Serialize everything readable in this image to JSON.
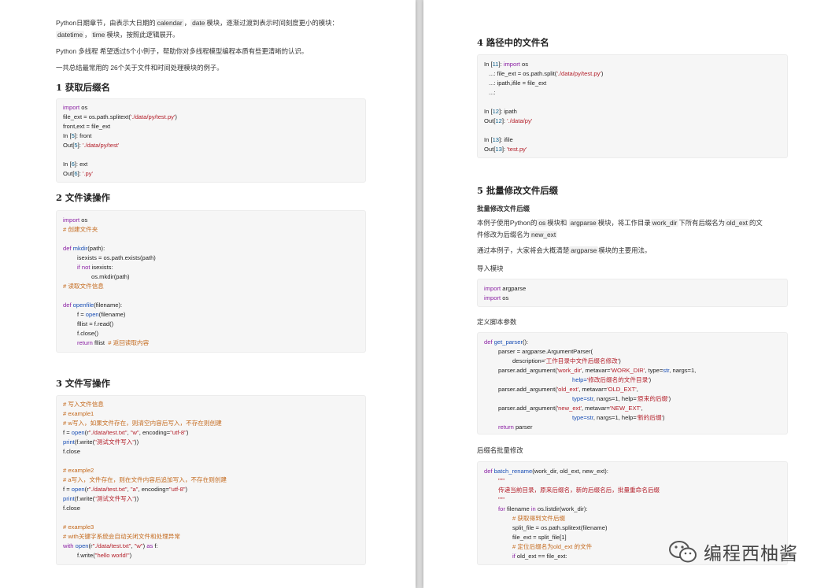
{
  "left": {
    "intro": {
      "p1a": "Python日期章节，由表示大日期的",
      "p1_c1": "calendar",
      "p1b": "，",
      "p1_c2": "date",
      "p1c": "模块，逐渐过渡到表示时间刻度更小的模块：",
      "p1_c3": "datetime",
      "p1d": "，",
      "p1_c4": "time",
      "p1e": "模块，按照此逻辑展开。",
      "p2": "Python 多线程 希望透过5个小例子，帮助你对多线程模型编程本质有些更清晰的认识。",
      "p3": "一共总结最常用的 26个关于文件和时间处理模块的例子。"
    },
    "s1": {
      "title": "1 获取后缀名",
      "code": {
        "l1_kw": "import",
        "l1_t": " os",
        "l2_a": "file_ext = os.path.splitext(",
        "l2_s": "'./data/py/test.py'",
        "l2_b": ")",
        "l3": "front,ext = file_ext",
        "l4_a": "In [",
        "l4_n": "5",
        "l4_b": "]: front",
        "l5_a": "Out[",
        "l5_n": "5",
        "l5_b": "]: ",
        "l5_s": "'./data/py/test'",
        "l6_a": "In [",
        "l6_n": "6",
        "l6_b": "]: ext",
        "l7_a": "Out[",
        "l7_n": "6",
        "l7_b": "]: ",
        "l7_s": "'.py'"
      }
    },
    "s2": {
      "title": "2 文件读操作",
      "code": {
        "l1_kw": "import",
        "l1_t": " os",
        "l2": "# 创建文件夹",
        "l3_kw": "def ",
        "l3_fn": "mkdir",
        "l3_t": "(path):",
        "l4": "isexists = os.path.exists(path)",
        "l5_kw": "if not",
        "l5_t": " isexists:",
        "l6": "os.mkdir(path)",
        "l7": "# 读取文件信息",
        "l8_kw": "def ",
        "l8_fn": "openfile",
        "l8_t": "(filename):",
        "l9_a": "f = ",
        "l9_b": "open",
        "l9_c": "(filename)",
        "l10": "fllist = f.read()",
        "l11": "f.close()",
        "l12_kw": "return",
        "l12_t": " fllist  ",
        "l12_cm": "# 返回读取内容"
      }
    },
    "s3": {
      "title": "3 文件写操作",
      "code": {
        "l1": "# 写入文件信息",
        "l2": "# example1",
        "l3": "# w写入，如果文件存在，则清空内容后写入，不存在则创建",
        "l4_a": "f = ",
        "l4_b": "open",
        "l4_c": "(r",
        "l4_s1": "\"./data/test.txt\"",
        "l4_d": ", ",
        "l4_s2": "\"w\"",
        "l4_e": ", encoding=",
        "l4_s3": "\"utf-8\"",
        "l4_f": ")",
        "l5_a": "print",
        "l5_b": "(f.write(",
        "l5_s": "\"测试文件写入\"",
        "l5_c": "))",
        "l6": "f.close",
        "l7": "# example2",
        "l8": "# a写入，文件存在，则在文件内容后追加写入，不存在则创建",
        "l9_a": "f = ",
        "l9_b": "open",
        "l9_c": "(r",
        "l9_s1": "\"./data/test.txt\"",
        "l9_d": ", ",
        "l9_s2": "\"a\"",
        "l9_e": ", encoding=",
        "l9_s3": "\"utf-8\"",
        "l9_f": ")",
        "l10_a": "print",
        "l10_b": "(f.write(",
        "l10_s": "\"测试文件写入\"",
        "l10_c": "))",
        "l11": "f.close",
        "l12": "# example3",
        "l13": "# with关键字系统会自动关闭文件和处理异常",
        "l14_kw": "with ",
        "l14_b": "open",
        "l14_c": "(r",
        "l14_s1": "\"./data/test.txt\"",
        "l14_d": ", ",
        "l14_s2": "\"w\"",
        "l14_e": ") ",
        "l14_kw2": "as",
        "l14_f": " f:",
        "l15_a": "f.write(",
        "l15_s": "\"hello world!\"",
        "l15_b": ")"
      }
    }
  },
  "right": {
    "s4": {
      "title": "4 路径中的文件名",
      "code": {
        "l1_a": "In [",
        "l1_n": "11",
        "l1_b": "]: ",
        "l1_kw": "import",
        "l1_t": " os",
        "l2_a": "...: file_ext = os.path.split(",
        "l2_s": "'./data/py/test.py'",
        "l2_b": ")",
        "l3": "...: ipath,ifile = file_ext",
        "l4": "...:",
        "l5_a": "In [",
        "l5_n": "12",
        "l5_b": "]: ipath",
        "l6_a": "Out[",
        "l6_n": "12",
        "l6_b": "]: ",
        "l6_s": "'./data/py'",
        "l7_a": "In [",
        "l7_n": "13",
        "l7_b": "]: ifile",
        "l8_a": "Out[",
        "l8_n": "13",
        "l8_b": "]: ",
        "l8_s": "'test.py'"
      }
    },
    "s5": {
      "title": "5 批量修改文件后缀",
      "sub_title": "批量修改文件后缀",
      "p1a": "本例子使用Python的",
      "p1_c1": "os",
      "p1b": "模块和 ",
      "p1_c2": "argparse",
      "p1c": "模块，将工作目录",
      "p1_c3": "work_dir",
      "p1d": "下所有后缀名为",
      "p1_c4": "old_ext",
      "p1e": "的文",
      "p2a": "件修改为后缀名为",
      "p2_c1": "new_ext",
      "p3a": "通过本例子，大家将会大概清楚",
      "p3_c1": "argparse",
      "p3b": "模块的主要用法。",
      "label_import": "导入模块",
      "code_import": {
        "l1_kw": "import",
        "l1_t": " argparse",
        "l2_kw": "import",
        "l2_t": " os"
      },
      "label_args": "定义脚本参数",
      "code_args": {
        "l1_kw": "def ",
        "l1_fn": "get_parser",
        "l1_t": "():",
        "l2": "parser = argparse.ArgumentParser(",
        "l3_a": "description=",
        "l3_s": "'工作目录中文件后缀名修改'",
        "l3_b": ")",
        "l4_a": "parser.add_argument(",
        "l4_s1": "'work_dir'",
        "l4_b": ", metavar=",
        "l4_s2": "'WORK_DIR'",
        "l4_c": ", type=",
        "l4_k": "str",
        "l4_d": ", nargs=1,",
        "l5_a": "help=",
        "l5_s": "'修改后缀名的文件目录'",
        "l5_b": ")",
        "l6_a": "parser.add_argument(",
        "l6_s1": "'old_ext'",
        "l6_b": ", metavar=",
        "l6_s2": "'OLD_EXT'",
        "l6_c": ",",
        "l7_a": "type=",
        "l7_k": "str",
        "l7_b": ", nargs=1, help=",
        "l7_s": "'原来的后缀'",
        "l7_c": ")",
        "l8_a": "parser.add_argument(",
        "l8_s1": "'new_ext'",
        "l8_b": ", metavar=",
        "l8_s2": "'NEW_EXT'",
        "l8_c": ",",
        "l9_a": "type=",
        "l9_k": "str",
        "l9_b": ", nargs=1, help=",
        "l9_s": "'新的后缀'",
        "l9_c": ")",
        "l10_kw": "return",
        "l10_t": " parser"
      },
      "label_batch": "后缀名批量修改",
      "code_batch": {
        "l1_kw": "def ",
        "l1_fn": "batch_rename",
        "l1_t": "(work_dir, old_ext, new_ext):",
        "l2": "\"\"\"",
        "l3": "传递当前目录，原来后缀名，新的后缀名后，批量重命名后缀",
        "l4": "\"\"\"",
        "l5_kw": "for",
        "l5_t": " filename ",
        "l5_kw2": "in",
        "l5_u": " os.listdir(work_dir):",
        "l6": "# 获取得到文件后缀",
        "l7": "split_file = os.path.splitext(filename)",
        "l8": "file_ext = split_file[1]",
        "l9": "# 定位后缀名为old_ext 的文件",
        "l10_kw": "if",
        "l10_t": " old_ext == file_ext:"
      }
    }
  },
  "watermark": {
    "text": "编程西柚酱",
    "icon": "wechat-icon"
  }
}
